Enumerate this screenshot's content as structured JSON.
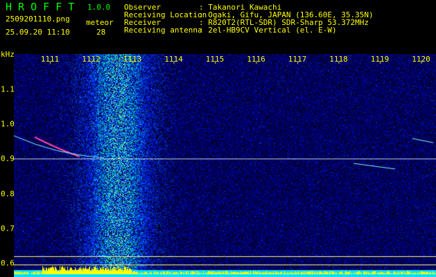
{
  "app": {
    "name": "H R O F F T",
    "version": "1.0.0"
  },
  "file": {
    "name": "2509201110.png",
    "datetime": "25.09.20 11:10"
  },
  "meteor": {
    "label": "meteor",
    "count": "28"
  },
  "info": [
    {
      "label": "Observer",
      "value": ": Takanori Kawachi"
    },
    {
      "label": "Receiving Location",
      "value": ": Ogaki, Gifu, JAPAN (136.60E, 35.35N)"
    },
    {
      "label": "Receiver",
      "value": ": R820T2(RTL-SDR) SDR-Sharp 53.372MHz"
    },
    {
      "label": "Receiving antenna",
      "value": ": 2el-HB9CV Vertical (el. E-W)"
    }
  ],
  "axes": {
    "y_unit": "kHz",
    "x_ticks": [
      "1111",
      "1112",
      "1113",
      "1114",
      "1115",
      "1116",
      "1117",
      "1118",
      "1119",
      "1120"
    ],
    "y_ticks": [
      "1.1",
      "1.0",
      "0.9",
      "0.8",
      "0.7",
      "0.6"
    ]
  }
}
